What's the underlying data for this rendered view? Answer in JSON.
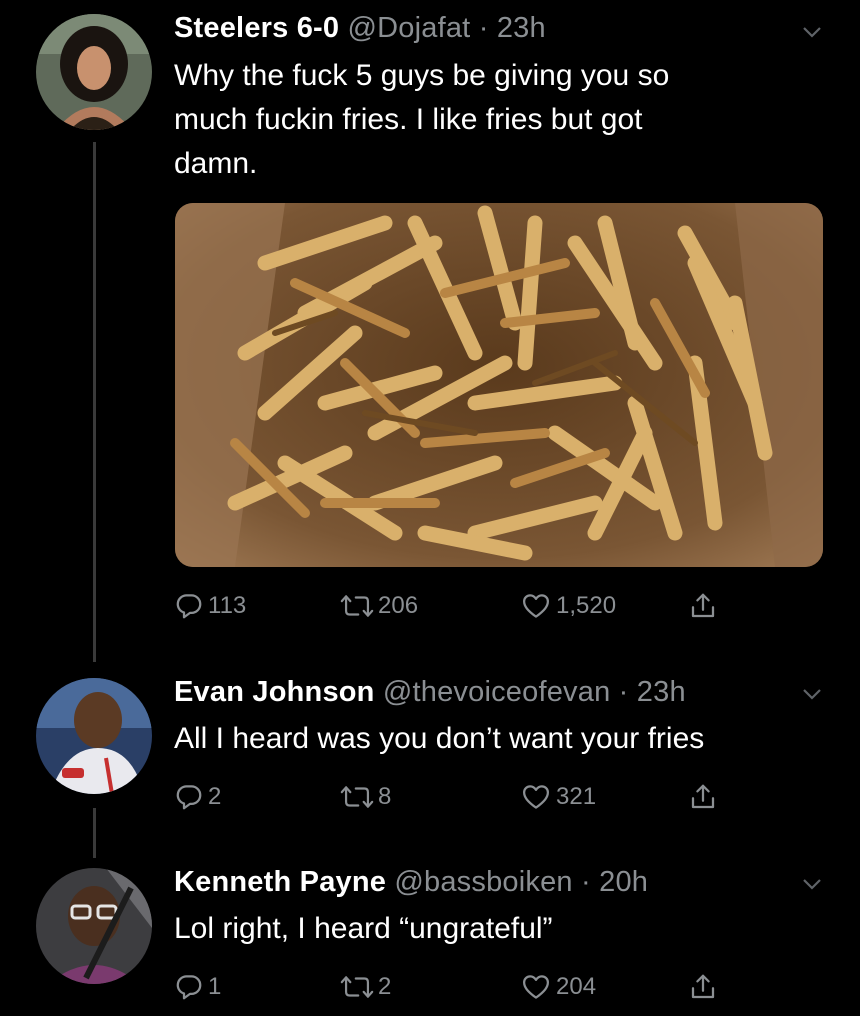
{
  "tweets": [
    {
      "display_name": "Steelers 6-0",
      "handle": "@Dojafat",
      "separator": "·",
      "time": "23h",
      "text_lines": [
        "Why the fuck 5 guys be giving you so",
        "much fuckin fries. I like fries but got",
        "damn."
      ],
      "replies": "113",
      "retweets": "206",
      "likes": "1,520"
    },
    {
      "display_name": "Evan Johnson",
      "handle": "@thevoiceofevan",
      "separator": "·",
      "time": "23h",
      "text_lines": [
        "All I heard was you don’t want your fries"
      ],
      "replies": "2",
      "retweets": "8",
      "likes": "321"
    },
    {
      "display_name": "Kenneth Payne",
      "handle": "@bassboiken",
      "separator": "·",
      "time": "20h",
      "text_lines": [
        "Lol right, I heard “ungrateful”"
      ],
      "replies": "1",
      "retweets": "2",
      "likes": "204"
    }
  ],
  "icons": {
    "reply": "reply-icon",
    "retweet": "retweet-icon",
    "like": "heart-icon",
    "share": "share-icon",
    "more": "chevron-down-icon"
  },
  "colors": {
    "background": "#000000",
    "secondary_text": "#8b8f93",
    "thread_line": "#3a3a3a"
  }
}
